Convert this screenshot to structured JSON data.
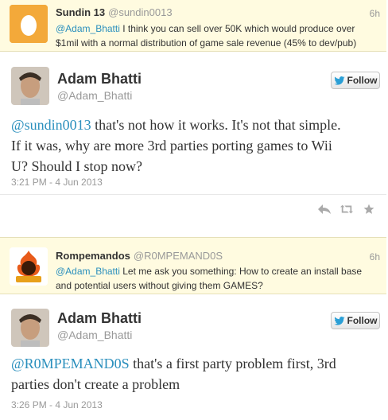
{
  "tweets": [
    {
      "type": "reply",
      "name": "Sundin 13",
      "handle": "@sundin0013",
      "time": "6h",
      "mention": "@Adam_Bhatti",
      "text_line1": " I think you can sell over 50K which would produce over",
      "text_line2": "$1mil with a normal distribution of game sale revenue (45% to dev/pub)",
      "avatar_icon": "egg-avatar"
    },
    {
      "type": "main",
      "name": "Adam Bhatti",
      "handle": "@Adam_Bhatti",
      "follow_label": "Follow",
      "mention": "@sundin0013",
      "text_line1": " that's not how it works. It's not that simple.",
      "text_line2": "If it was, why are more 3rd parties porting games to Wii",
      "text_line3": "U? Should I stop now?",
      "timestamp": "3:21 PM - 4 Jun 2013"
    },
    {
      "type": "reply",
      "name": "Rompemandos",
      "handle": "@R0MPEMAND0S",
      "time": "6h",
      "mention": "@Adam_Bhatti",
      "text_line1": " Let me ask you something: How to create an install base",
      "text_line2": "and potential users without giving them GAMES?",
      "avatar_icon": "rompemandos-logo"
    },
    {
      "type": "main",
      "name": "Adam Bhatti",
      "handle": "@Adam_Bhatti",
      "follow_label": "Follow",
      "mention": "@R0MPEMAND0S",
      "text_line1": " that's a first party problem first, 3rd",
      "text_line2": "parties don't create a problem",
      "timestamp": "3:26 PM - 4 Jun 2013"
    }
  ],
  "colors": {
    "link": "#2a8fbd",
    "reply_bg": "#fffbe0",
    "muted": "#999999"
  },
  "icons": [
    "reply-icon",
    "retweet-icon",
    "favorite-icon",
    "twitter-bird-icon"
  ]
}
